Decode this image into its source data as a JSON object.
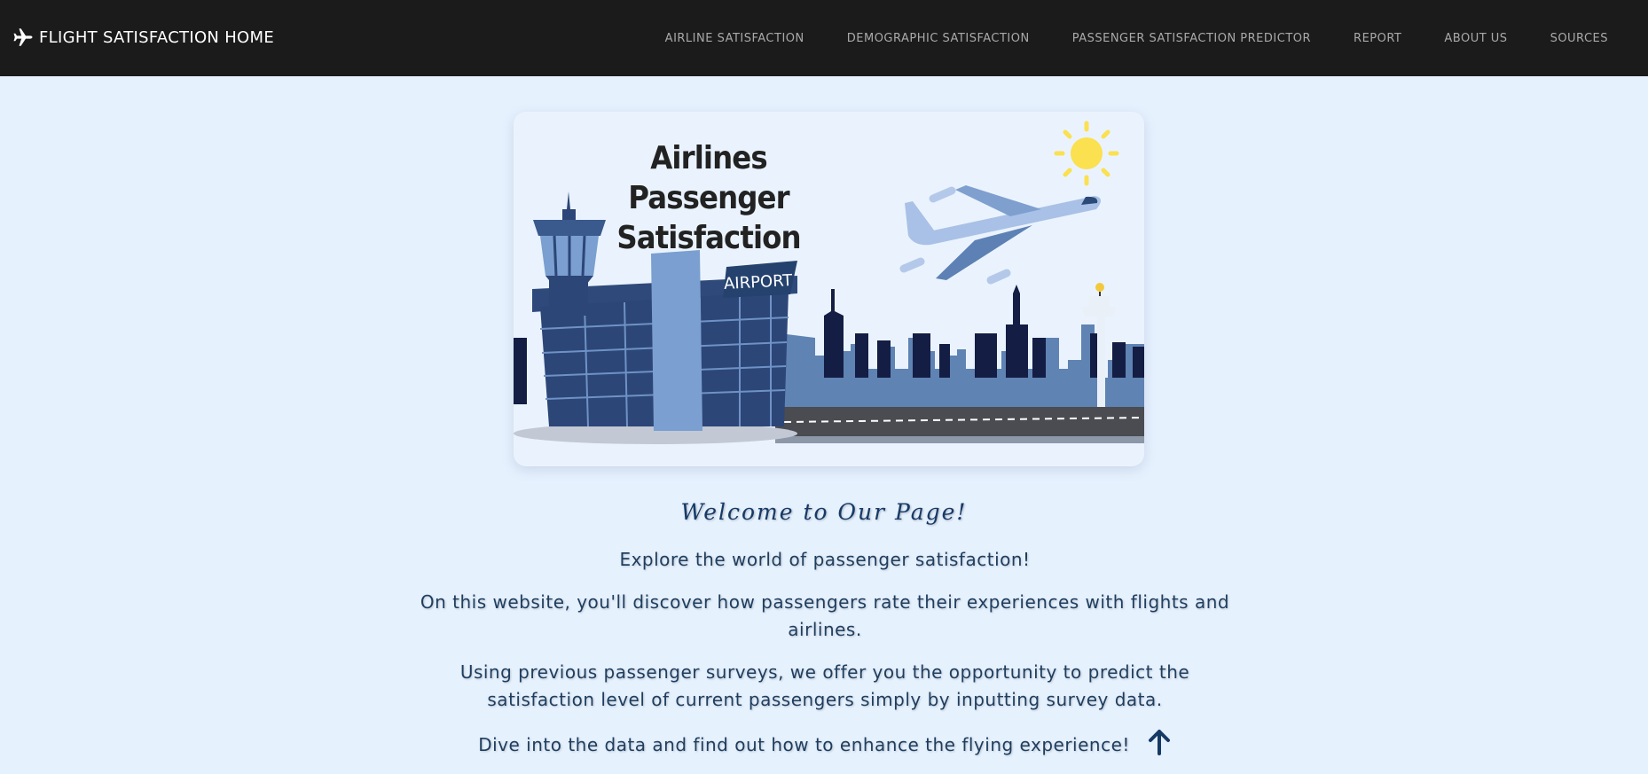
{
  "navbar": {
    "brand_label": "FLIGHT SATISFACTION HOME",
    "brand_icon": "airplane-icon",
    "links": [
      {
        "label": "AIRLINE SATISFACTION"
      },
      {
        "label": "DEMOGRAPHIC SATISFACTION"
      },
      {
        "label": "PASSENGER SATISFACTION PREDICTOR"
      },
      {
        "label": "REPORT"
      },
      {
        "label": "ABOUT US"
      },
      {
        "label": "SOURCES"
      }
    ]
  },
  "hero": {
    "title_line1": "Airlines Passenger",
    "title_line2": "Satisfaction",
    "airport_sign": "AIRPORT"
  },
  "content": {
    "welcome": "Welcome to Our Page!",
    "paragraph1": "Explore the world of passenger satisfaction!",
    "paragraph2": "On this website, you'll discover how passengers rate their experiences with flights and airlines.",
    "paragraph3": "Using previous passenger surveys, we offer you the opportunity to predict the satisfaction level of current passengers simply by inputting survey data.",
    "paragraph4": "Dive into the data and find out how to enhance the flying experience!",
    "scroll_icon": "arrow-up-icon"
  },
  "colors": {
    "navbar_bg": "#1b1b1b",
    "page_bg": "#e6f1fe",
    "heading_text": "#163a66",
    "body_text": "#1f3e5e"
  }
}
